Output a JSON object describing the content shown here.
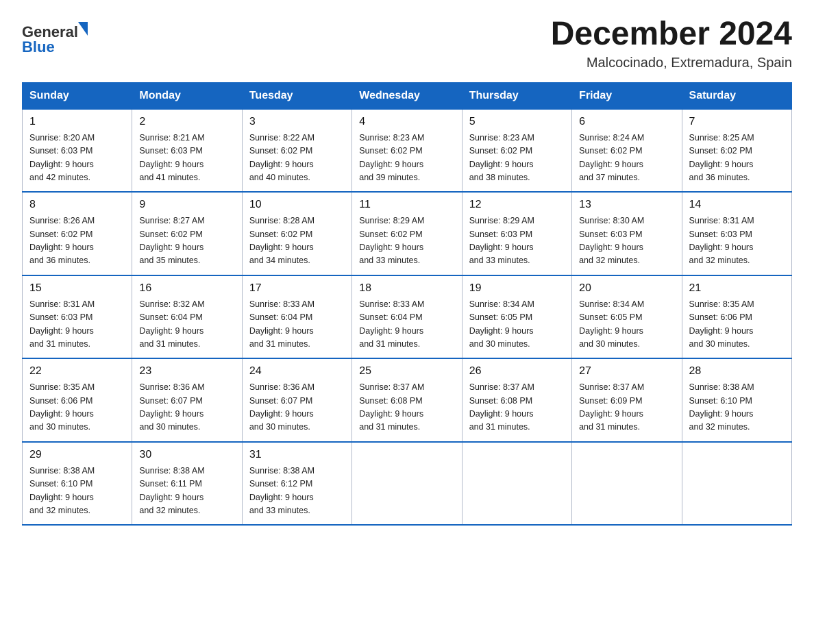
{
  "header": {
    "title": "December 2024",
    "subtitle": "Malcocinado, Extremadura, Spain"
  },
  "logo": {
    "line1": "General",
    "line2": "Blue"
  },
  "days_of_week": [
    "Sunday",
    "Monday",
    "Tuesday",
    "Wednesday",
    "Thursday",
    "Friday",
    "Saturday"
  ],
  "weeks": [
    [
      {
        "day": "1",
        "sunrise": "8:20 AM",
        "sunset": "6:03 PM",
        "daylight": "9 hours and 42 minutes."
      },
      {
        "day": "2",
        "sunrise": "8:21 AM",
        "sunset": "6:03 PM",
        "daylight": "9 hours and 41 minutes."
      },
      {
        "day": "3",
        "sunrise": "8:22 AM",
        "sunset": "6:02 PM",
        "daylight": "9 hours and 40 minutes."
      },
      {
        "day": "4",
        "sunrise": "8:23 AM",
        "sunset": "6:02 PM",
        "daylight": "9 hours and 39 minutes."
      },
      {
        "day": "5",
        "sunrise": "8:23 AM",
        "sunset": "6:02 PM",
        "daylight": "9 hours and 38 minutes."
      },
      {
        "day": "6",
        "sunrise": "8:24 AM",
        "sunset": "6:02 PM",
        "daylight": "9 hours and 37 minutes."
      },
      {
        "day": "7",
        "sunrise": "8:25 AM",
        "sunset": "6:02 PM",
        "daylight": "9 hours and 36 minutes."
      }
    ],
    [
      {
        "day": "8",
        "sunrise": "8:26 AM",
        "sunset": "6:02 PM",
        "daylight": "9 hours and 36 minutes."
      },
      {
        "day": "9",
        "sunrise": "8:27 AM",
        "sunset": "6:02 PM",
        "daylight": "9 hours and 35 minutes."
      },
      {
        "day": "10",
        "sunrise": "8:28 AM",
        "sunset": "6:02 PM",
        "daylight": "9 hours and 34 minutes."
      },
      {
        "day": "11",
        "sunrise": "8:29 AM",
        "sunset": "6:02 PM",
        "daylight": "9 hours and 33 minutes."
      },
      {
        "day": "12",
        "sunrise": "8:29 AM",
        "sunset": "6:03 PM",
        "daylight": "9 hours and 33 minutes."
      },
      {
        "day": "13",
        "sunrise": "8:30 AM",
        "sunset": "6:03 PM",
        "daylight": "9 hours and 32 minutes."
      },
      {
        "day": "14",
        "sunrise": "8:31 AM",
        "sunset": "6:03 PM",
        "daylight": "9 hours and 32 minutes."
      }
    ],
    [
      {
        "day": "15",
        "sunrise": "8:31 AM",
        "sunset": "6:03 PM",
        "daylight": "9 hours and 31 minutes."
      },
      {
        "day": "16",
        "sunrise": "8:32 AM",
        "sunset": "6:04 PM",
        "daylight": "9 hours and 31 minutes."
      },
      {
        "day": "17",
        "sunrise": "8:33 AM",
        "sunset": "6:04 PM",
        "daylight": "9 hours and 31 minutes."
      },
      {
        "day": "18",
        "sunrise": "8:33 AM",
        "sunset": "6:04 PM",
        "daylight": "9 hours and 31 minutes."
      },
      {
        "day": "19",
        "sunrise": "8:34 AM",
        "sunset": "6:05 PM",
        "daylight": "9 hours and 30 minutes."
      },
      {
        "day": "20",
        "sunrise": "8:34 AM",
        "sunset": "6:05 PM",
        "daylight": "9 hours and 30 minutes."
      },
      {
        "day": "21",
        "sunrise": "8:35 AM",
        "sunset": "6:06 PM",
        "daylight": "9 hours and 30 minutes."
      }
    ],
    [
      {
        "day": "22",
        "sunrise": "8:35 AM",
        "sunset": "6:06 PM",
        "daylight": "9 hours and 30 minutes."
      },
      {
        "day": "23",
        "sunrise": "8:36 AM",
        "sunset": "6:07 PM",
        "daylight": "9 hours and 30 minutes."
      },
      {
        "day": "24",
        "sunrise": "8:36 AM",
        "sunset": "6:07 PM",
        "daylight": "9 hours and 30 minutes."
      },
      {
        "day": "25",
        "sunrise": "8:37 AM",
        "sunset": "6:08 PM",
        "daylight": "9 hours and 31 minutes."
      },
      {
        "day": "26",
        "sunrise": "8:37 AM",
        "sunset": "6:08 PM",
        "daylight": "9 hours and 31 minutes."
      },
      {
        "day": "27",
        "sunrise": "8:37 AM",
        "sunset": "6:09 PM",
        "daylight": "9 hours and 31 minutes."
      },
      {
        "day": "28",
        "sunrise": "8:38 AM",
        "sunset": "6:10 PM",
        "daylight": "9 hours and 32 minutes."
      }
    ],
    [
      {
        "day": "29",
        "sunrise": "8:38 AM",
        "sunset": "6:10 PM",
        "daylight": "9 hours and 32 minutes."
      },
      {
        "day": "30",
        "sunrise": "8:38 AM",
        "sunset": "6:11 PM",
        "daylight": "9 hours and 32 minutes."
      },
      {
        "day": "31",
        "sunrise": "8:38 AM",
        "sunset": "6:12 PM",
        "daylight": "9 hours and 33 minutes."
      },
      null,
      null,
      null,
      null
    ]
  ],
  "labels": {
    "sunrise": "Sunrise:",
    "sunset": "Sunset:",
    "daylight": "Daylight:"
  }
}
